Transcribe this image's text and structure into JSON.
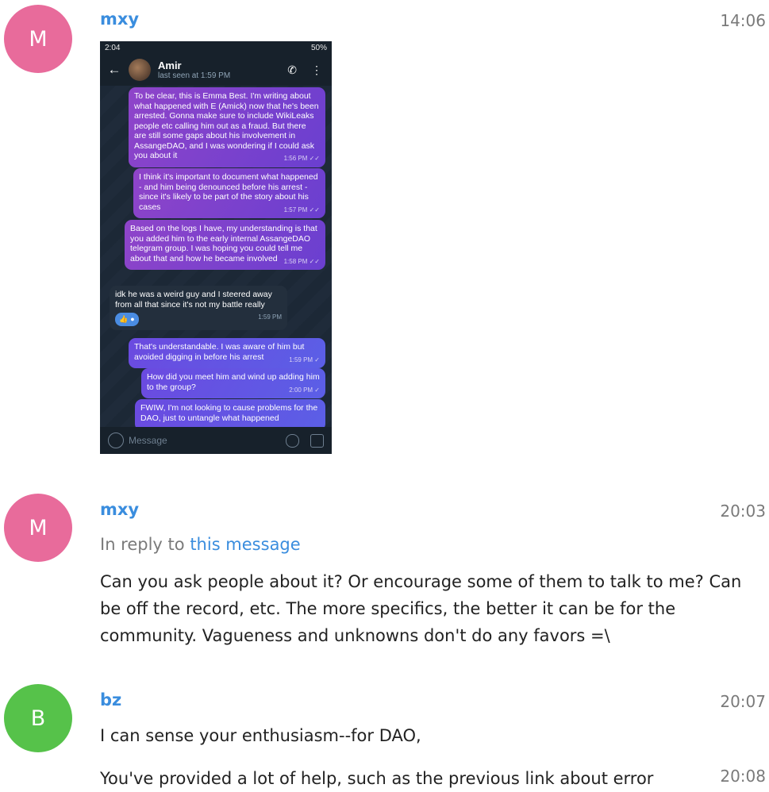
{
  "messages": [
    {
      "avatar_letter": "M",
      "avatar_color": "#e86b9b",
      "author": "mxy",
      "time": "14:06",
      "image": {
        "status_time": "2:04",
        "status_right": "50%",
        "contact_name": "Amir",
        "contact_status": "last seen at 1:59 PM",
        "bubbles": [
          {
            "text": "To be clear, this is Emma Best. I'm writing about what happened with E (Amick) now that he's been arrested. Gonna make sure to include WikiLeaks people etc calling him out as a fraud. But there are still some gaps about his involvement in AssangeDAO, and I was wondering if I could ask you about it",
            "time": "1:56 PM ✓✓"
          },
          {
            "text": "I think it's important to document what happened - and him being denounced before his arrest - since it's likely to be part of the story about his cases",
            "time": "1:57 PM ✓✓"
          },
          {
            "text": "Based on the logs I have, my understanding is that you added him to the early internal AssangeDAO telegram group. I was hoping you could tell me about that and how he became involved",
            "time": "1:58 PM ✓✓"
          },
          {
            "text": "idk he was a weird guy and I steered away from all that since it's not my battle really",
            "time": "1:59 PM"
          },
          {
            "text": "That's understandable. I was aware of him but avoided digging in before his arrest",
            "time": "1:59 PM ✓"
          },
          {
            "text": "How did you meet him and wind up adding him to the group?",
            "time": "2:00 PM ✓"
          },
          {
            "text": "FWIW, I'm not looking to cause problems for the DAO, just to untangle what happened",
            "time": ""
          }
        ],
        "input_placeholder": "Message"
      }
    },
    {
      "avatar_letter": "M",
      "avatar_color": "#e86b9b",
      "author": "mxy",
      "time": "20:03",
      "reply_prefix": "In reply to",
      "reply_link": "this message",
      "text": "Can you ask people about it? Or encourage some of them to talk to me? Can be off the record, etc. The more specifics, the better it can be for the community. Vagueness and unknowns don't do any favors =\\"
    },
    {
      "avatar_letter": "B",
      "avatar_color": "#56c24a",
      "author": "bz",
      "time": "20:07",
      "text": "I can sense your enthusiasm--for DAO,"
    },
    {
      "author": "",
      "time": "20:08",
      "text": "You've provided a lot of help, such as the previous link about error"
    }
  ]
}
